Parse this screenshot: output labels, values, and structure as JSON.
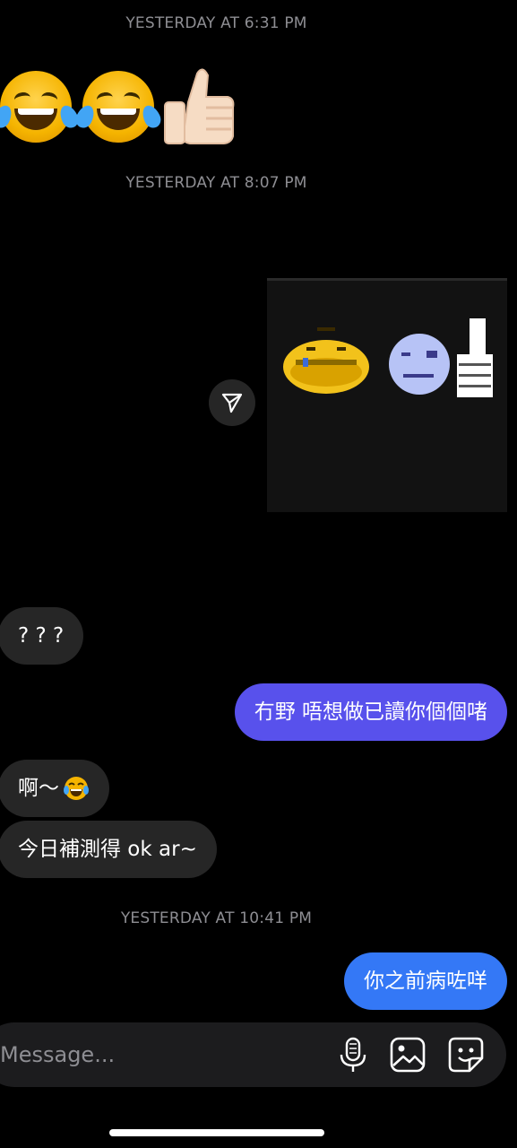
{
  "timestamps": [
    "YESTERDAY AT 6:31 PM",
    "YESTERDAY AT 8:07 PM",
    "YESTERDAY AT 10:41 PM"
  ],
  "messages": {
    "m1": "? ? ?",
    "m2": "冇野 唔想做已讀你個個啫",
    "m3": "啊～",
    "m4": "今日補測得 ok ar~",
    "m5": "你之前病咗咩"
  },
  "composer": {
    "placeholder": "Message..."
  },
  "icons": {
    "share": "send-icon",
    "mic": "microphone-icon",
    "gallery": "gallery-icon",
    "sticker": "sticker-icon"
  },
  "colors": {
    "purple_bubble": "#5851ec",
    "blue_bubble": "#3478f6",
    "incoming_bubble": "#262626"
  }
}
